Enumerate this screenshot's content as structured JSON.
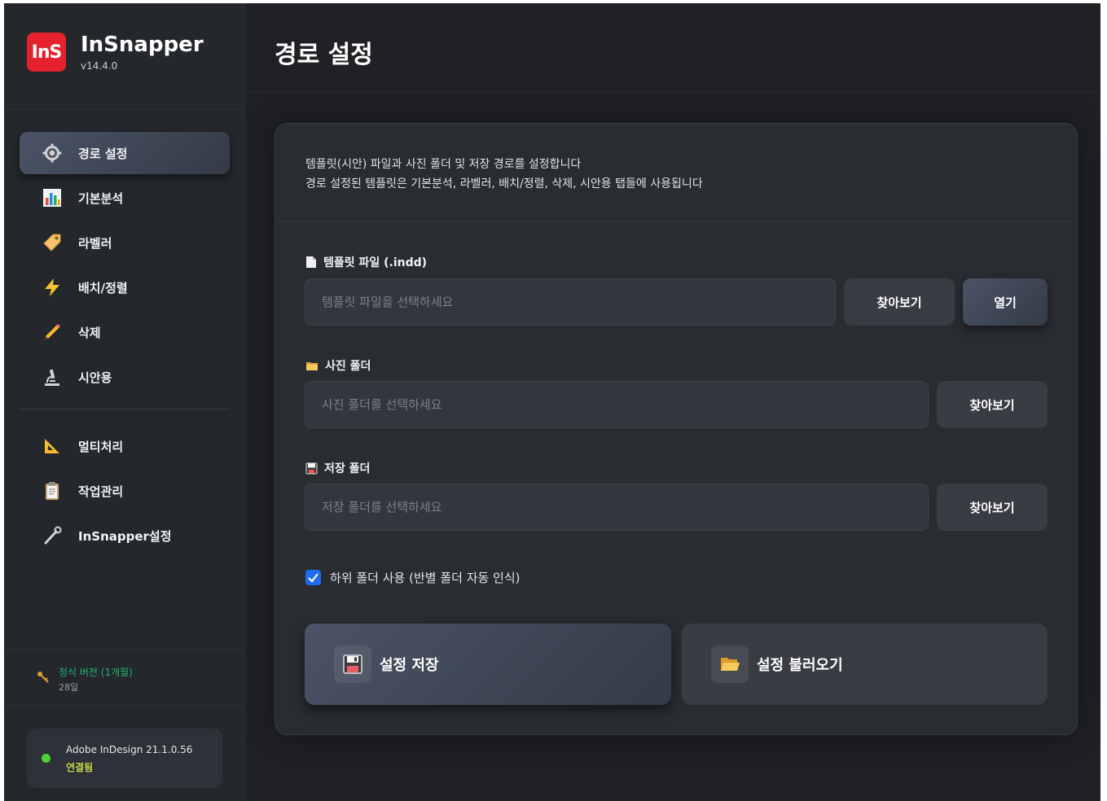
{
  "brand": {
    "logo_text": "InS",
    "name": "InSnapper",
    "version": "v14.4.0"
  },
  "sidebar": {
    "items": [
      {
        "label": "경로 설정",
        "icon": "gear-icon",
        "active": true
      },
      {
        "label": "기본분석",
        "icon": "bar-chart-icon"
      },
      {
        "label": "라벨러",
        "icon": "tag-icon"
      },
      {
        "label": "배치/정렬",
        "icon": "lightning-icon"
      },
      {
        "label": "삭제",
        "icon": "pencil-icon"
      },
      {
        "label": "시안용",
        "icon": "microscope-icon"
      }
    ],
    "items2": [
      {
        "label": "멀티처리",
        "icon": "triangle-ruler-icon"
      },
      {
        "label": "작업관리",
        "icon": "clipboard-icon"
      },
      {
        "label": "InSnapper설정",
        "icon": "wrench-icon"
      }
    ],
    "license": {
      "type": "정식 버전 (1개월)",
      "days": "28일"
    },
    "connection": {
      "app": "Adobe InDesign 21.1.0.56",
      "status": "연결됨"
    }
  },
  "header": {
    "title": "경로 설정"
  },
  "panel": {
    "desc_line1": "템플릿(시안) 파일과 사진 폴더 및 저장 경로를 설정합니다",
    "desc_line2": "경로 설정된 템플릿은 기본분석, 라벨러, 배치/정렬, 삭제, 시안용 탭들에 사용됩니다",
    "template": {
      "label": "템플릿 파일 (.indd)",
      "placeholder": "템플릿 파일을 선택하세요",
      "value": "",
      "browse": "찾아보기",
      "open": "열기"
    },
    "photo": {
      "label": "사진 폴더",
      "placeholder": "사진 폴더를 선택하세요",
      "value": "",
      "browse": "찾아보기"
    },
    "save": {
      "label": "저장 폴더",
      "placeholder": "저장 폴더를 선택하세요",
      "value": "",
      "browse": "찾아보기"
    },
    "subfolder": {
      "label": "하위 폴더 사용 (반별 폴더 자동 인식)",
      "checked": true
    },
    "save_settings": "설정 저장",
    "load_settings": "설정 불러오기"
  },
  "colors": {
    "accent": "#e5212d",
    "license_green": "#22b573",
    "connected": "#4cd137",
    "checkbox": "#1d6cf2"
  }
}
